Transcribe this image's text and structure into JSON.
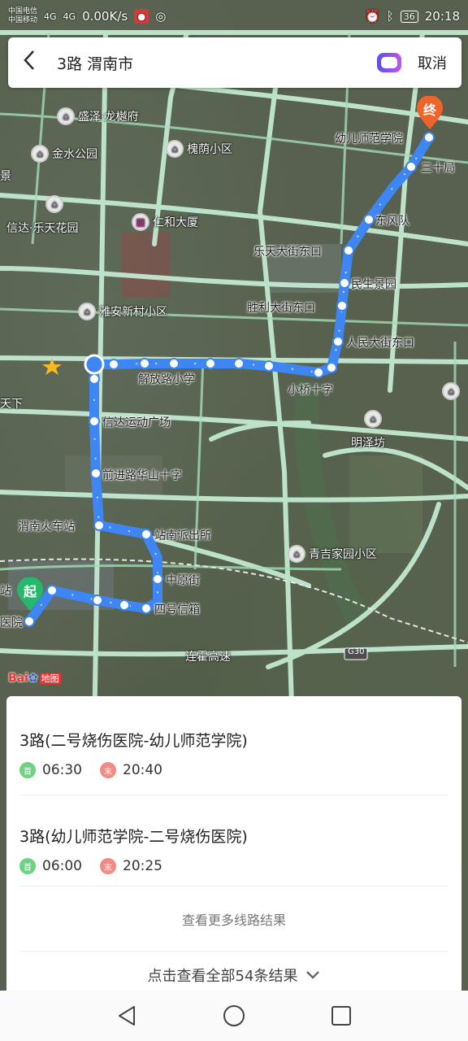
{
  "status_bar": {
    "carrier_top": "中国电信",
    "carrier_bottom": "中国移动",
    "signal_left": "4G",
    "signal_right": "4G",
    "net_speed": "0.00K/s",
    "battery": "36",
    "time": "20:18"
  },
  "search": {
    "query": "3路 渭南市",
    "cancel_label": "取消"
  },
  "map": {
    "places": [
      "盛泽·龙樾府",
      "金水公园",
      "槐荫小区",
      "信达·乐天花园",
      "仁和大厦",
      "雅安新村小区",
      "明泽坊",
      "青吉家园小区",
      "连霍高速",
      "天下",
      "景",
      "站",
      "医院"
    ],
    "stops": [
      "幼儿师范学院",
      "三十局",
      "东风队",
      "乐天大街东口",
      "民生景园",
      "胜利大街东口",
      "人民大街东口",
      "小桥十字",
      "解放路小学",
      "信达运动广场",
      "前进路华山十字",
      "渭南火车站",
      "站南派出所",
      "中原街",
      "四号信箱"
    ],
    "start_marker": "起",
    "end_marker": "终",
    "highway_shield": "G30",
    "brand": "Bai",
    "brand_suffix": "地图"
  },
  "results": [
    {
      "name": "3路(二号烧伤医院-幼儿师范学院)",
      "first_label": "首",
      "first_time": "06:30",
      "last_label": "末",
      "last_time": "20:40"
    },
    {
      "name": "3路(幼儿师范学院-二号烧伤医院)",
      "first_label": "首",
      "first_time": "06:00",
      "last_label": "末",
      "last_time": "20:25"
    }
  ],
  "more_routes_label": "查看更多线路结果",
  "all_results_label": "点击查看全部54条结果",
  "colors": {
    "route": "#3d86f3",
    "road": "#c8f0d8",
    "accent_end": "#f0642a",
    "accent_start": "#27b96b"
  }
}
